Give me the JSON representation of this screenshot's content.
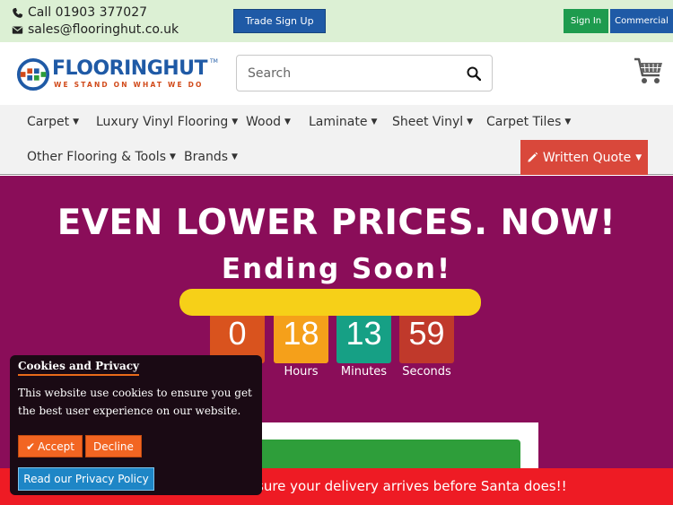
{
  "topbar": {
    "phone": "Call 01903 377027",
    "email": "sales@flooringhut.co.uk",
    "trade_signup": "Trade Sign Up",
    "sign_in": "Sign In",
    "commercial": "Commercial"
  },
  "header": {
    "logo_word_1": "FLOORING",
    "logo_word_2": "HUT",
    "logo_tm": "TM",
    "logo_tagline": "WE STAND ON WHAT WE DO",
    "search_placeholder": "Search"
  },
  "nav": {
    "items": [
      {
        "label": "Carpet"
      },
      {
        "label": "Luxury Vinyl Flooring"
      },
      {
        "label": "Wood"
      },
      {
        "label": "Laminate"
      },
      {
        "label": "Sheet Vinyl"
      },
      {
        "label": "Carpet Tiles"
      },
      {
        "label": "Other Flooring & Tools"
      },
      {
        "label": "Brands"
      }
    ],
    "quote": "Written Quote"
  },
  "hero": {
    "headline": "EVEN LOWER PRICES. NOW!",
    "subhead": "Ending Soon!",
    "countdown": [
      {
        "value": "0",
        "label": "",
        "color": "#d9531e"
      },
      {
        "value": "18",
        "label": "Hours",
        "color": "#f5a01a"
      },
      {
        "value": "13",
        "label": "Minutes",
        "color": "#16a085"
      },
      {
        "value": "59",
        "label": "Seconds",
        "color": "#c0392b"
      }
    ]
  },
  "banner": {
    "text": "sure your delivery arrives before Santa does!!"
  },
  "cookie": {
    "title": "Cookies and Privacy",
    "text": "This website use cookies to ensure you get the best user experience on our website.",
    "accept": "Accept",
    "decline": "Decline",
    "privacy": "Read our Privacy Policy"
  },
  "colors": {
    "brand_blue": "#1f5aa6",
    "hero_bg": "#8a0d59",
    "banner_red": "#ee1b24",
    "accent_orange": "#f26522"
  }
}
